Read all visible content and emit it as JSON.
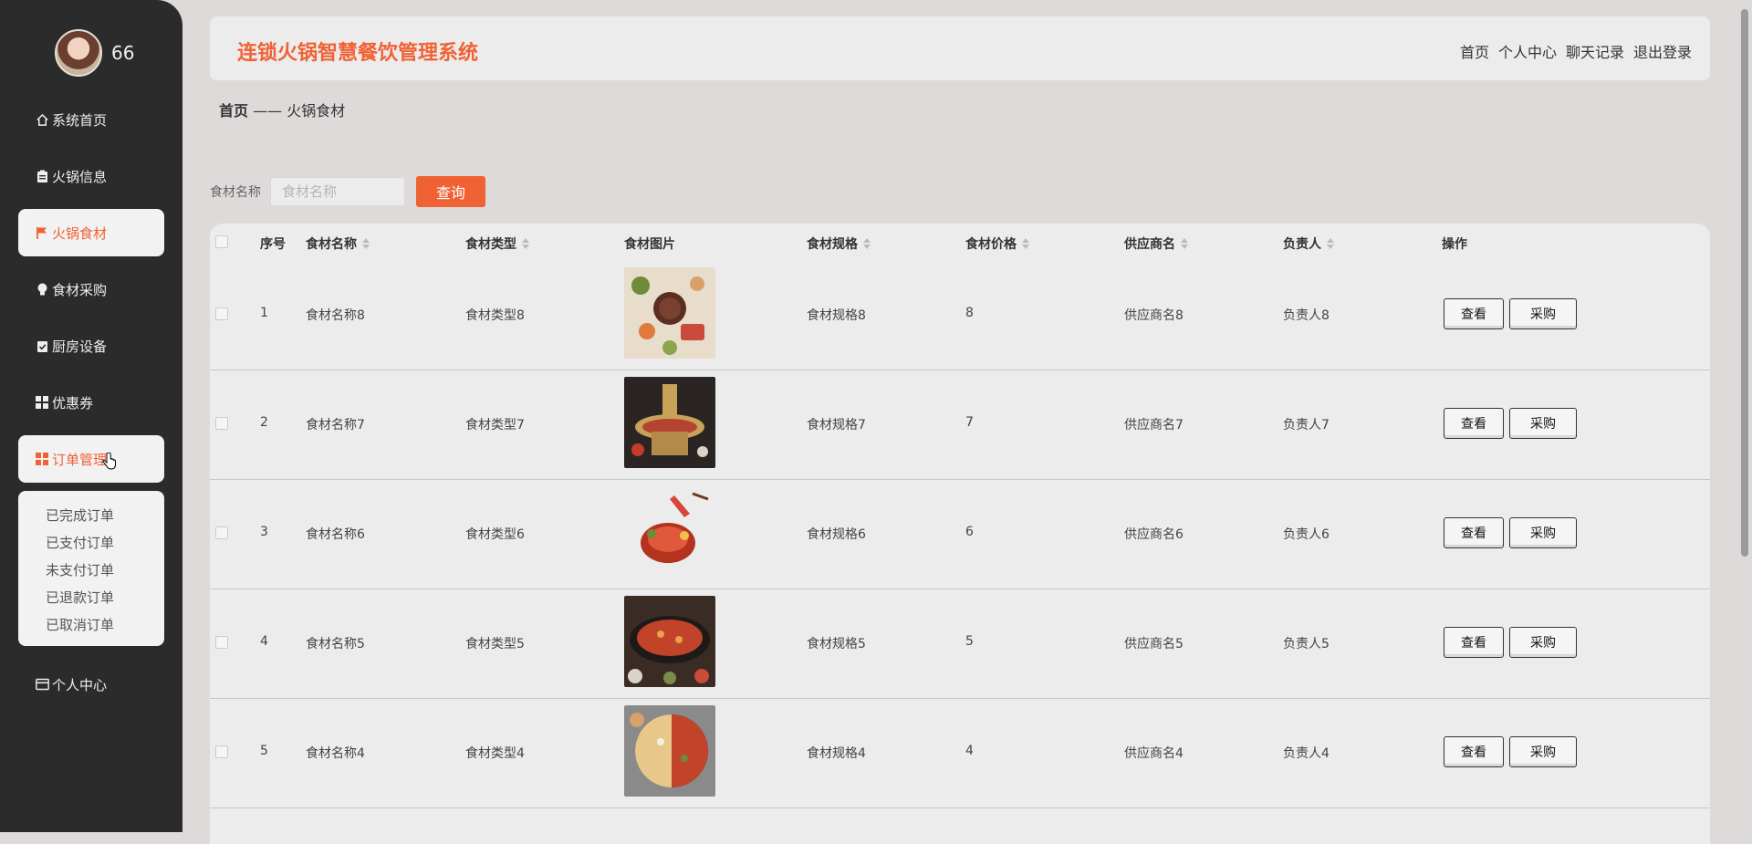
{
  "user": {
    "name": "66"
  },
  "sidebar": {
    "items": [
      {
        "label": "系统首页",
        "icon": "home-icon"
      },
      {
        "label": "火锅信息",
        "icon": "clipboard-icon"
      },
      {
        "label": "火锅食材",
        "icon": "flag-icon",
        "active": true
      },
      {
        "label": "食材采购",
        "icon": "bulb-icon"
      },
      {
        "label": "厨房设备",
        "icon": "checkbox-icon"
      },
      {
        "label": "优惠券",
        "icon": "grid-icon"
      },
      {
        "label": "订单管理",
        "icon": "grid-icon",
        "hover": true
      },
      {
        "label": "个人中心",
        "icon": "card-icon"
      }
    ],
    "order_submenu": [
      "已完成订单",
      "已支付订单",
      "未支付订单",
      "已退款订单",
      "已取消订单"
    ]
  },
  "header": {
    "title": "连锁火锅智慧餐饮管理系统",
    "links": [
      "首页",
      "个人中心",
      "聊天记录",
      "退出登录"
    ]
  },
  "breadcrumb": {
    "home": "首页",
    "sep": " —— ",
    "current": "火锅食材"
  },
  "search": {
    "label": "食材名称",
    "placeholder": "食材名称",
    "value": "",
    "button": "查询"
  },
  "table": {
    "headers": [
      "序号",
      "食材名称",
      "食材类型",
      "食材图片",
      "食材规格",
      "食材价格",
      "供应商名",
      "负责人",
      "操作"
    ],
    "rows": [
      {
        "no": "1",
        "name": "食材名称8",
        "type": "食材类型8",
        "spec": "食材规格8",
        "price": "8",
        "supplier": "供应商名8",
        "owner": "负责人8"
      },
      {
        "no": "2",
        "name": "食材名称7",
        "type": "食材类型7",
        "spec": "食材规格7",
        "price": "7",
        "supplier": "供应商名7",
        "owner": "负责人7"
      },
      {
        "no": "3",
        "name": "食材名称6",
        "type": "食材类型6",
        "spec": "食材规格6",
        "price": "6",
        "supplier": "供应商名6",
        "owner": "负责人6"
      },
      {
        "no": "4",
        "name": "食材名称5",
        "type": "食材类型5",
        "spec": "食材规格5",
        "price": "5",
        "supplier": "供应商名5",
        "owner": "负责人5"
      },
      {
        "no": "5",
        "name": "食材名称4",
        "type": "食材类型4",
        "spec": "食材规格4",
        "price": "4",
        "supplier": "供应商名4",
        "owner": "负责人4"
      }
    ],
    "actions": {
      "view": "查看",
      "buy": "采购"
    }
  },
  "colors": {
    "accent": "#f06234",
    "sidebar": "#2b2b2b",
    "background": "#dedad9"
  }
}
